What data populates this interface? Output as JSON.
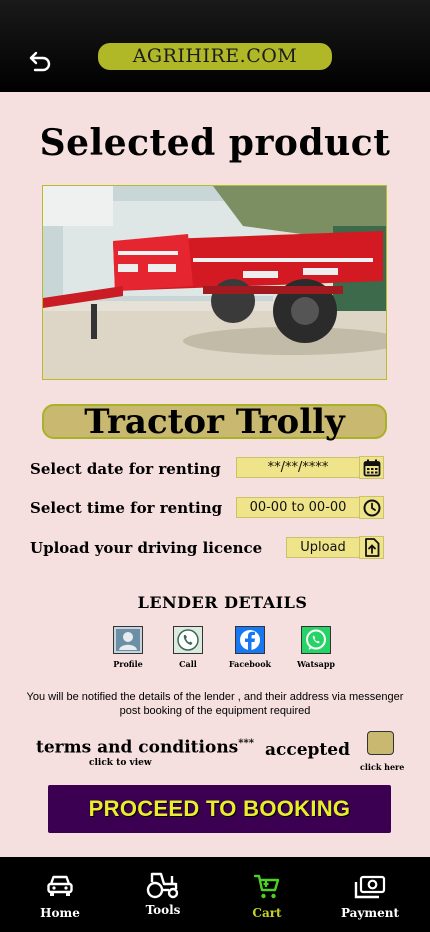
{
  "header": {
    "brand": "AGRIHIRE.COM",
    "back_icon": "back-arrow-icon"
  },
  "page_title": "Selected product",
  "product": {
    "image_alt": "Red tractor trolley trailer",
    "name": "Tractor Trolly"
  },
  "form": {
    "date_label": "Select date for renting",
    "date_value": "**/**/****",
    "time_label": "Select time for renting",
    "time_value": "00-00 to 00-00",
    "licence_label": "Upload your driving licence",
    "upload_label": "Upload"
  },
  "lender": {
    "title": "LENDER DETAILS",
    "contacts": [
      {
        "label": "Profile",
        "icon": "profile-icon"
      },
      {
        "label": "Call",
        "icon": "call-icon"
      },
      {
        "label": "Facebook",
        "icon": "facebook-icon"
      },
      {
        "label": "Watsapp",
        "icon": "whatsapp-icon"
      }
    ]
  },
  "notice": "You will be notified the details of the lender , and their address via messenger post booking of the equipment required",
  "terms": {
    "text": "terms and conditions",
    "stars": "***",
    "click_to_view": "click to view",
    "accepted": "accepted",
    "click_here": "click here"
  },
  "proceed_label": "PROCEED TO BOOKING",
  "nav": [
    {
      "label": "Home",
      "icon": "car-icon"
    },
    {
      "label": "Tools",
      "icon": "tractor-icon"
    },
    {
      "label": "Cart",
      "icon": "cart-icon",
      "active": true
    },
    {
      "label": "Payment",
      "icon": "payment-icon"
    }
  ],
  "colors": {
    "accent": "#b1b827",
    "button_bg": "#3c0052",
    "button_text": "#e8ef2a",
    "page_bg": "#f5dfdf"
  }
}
